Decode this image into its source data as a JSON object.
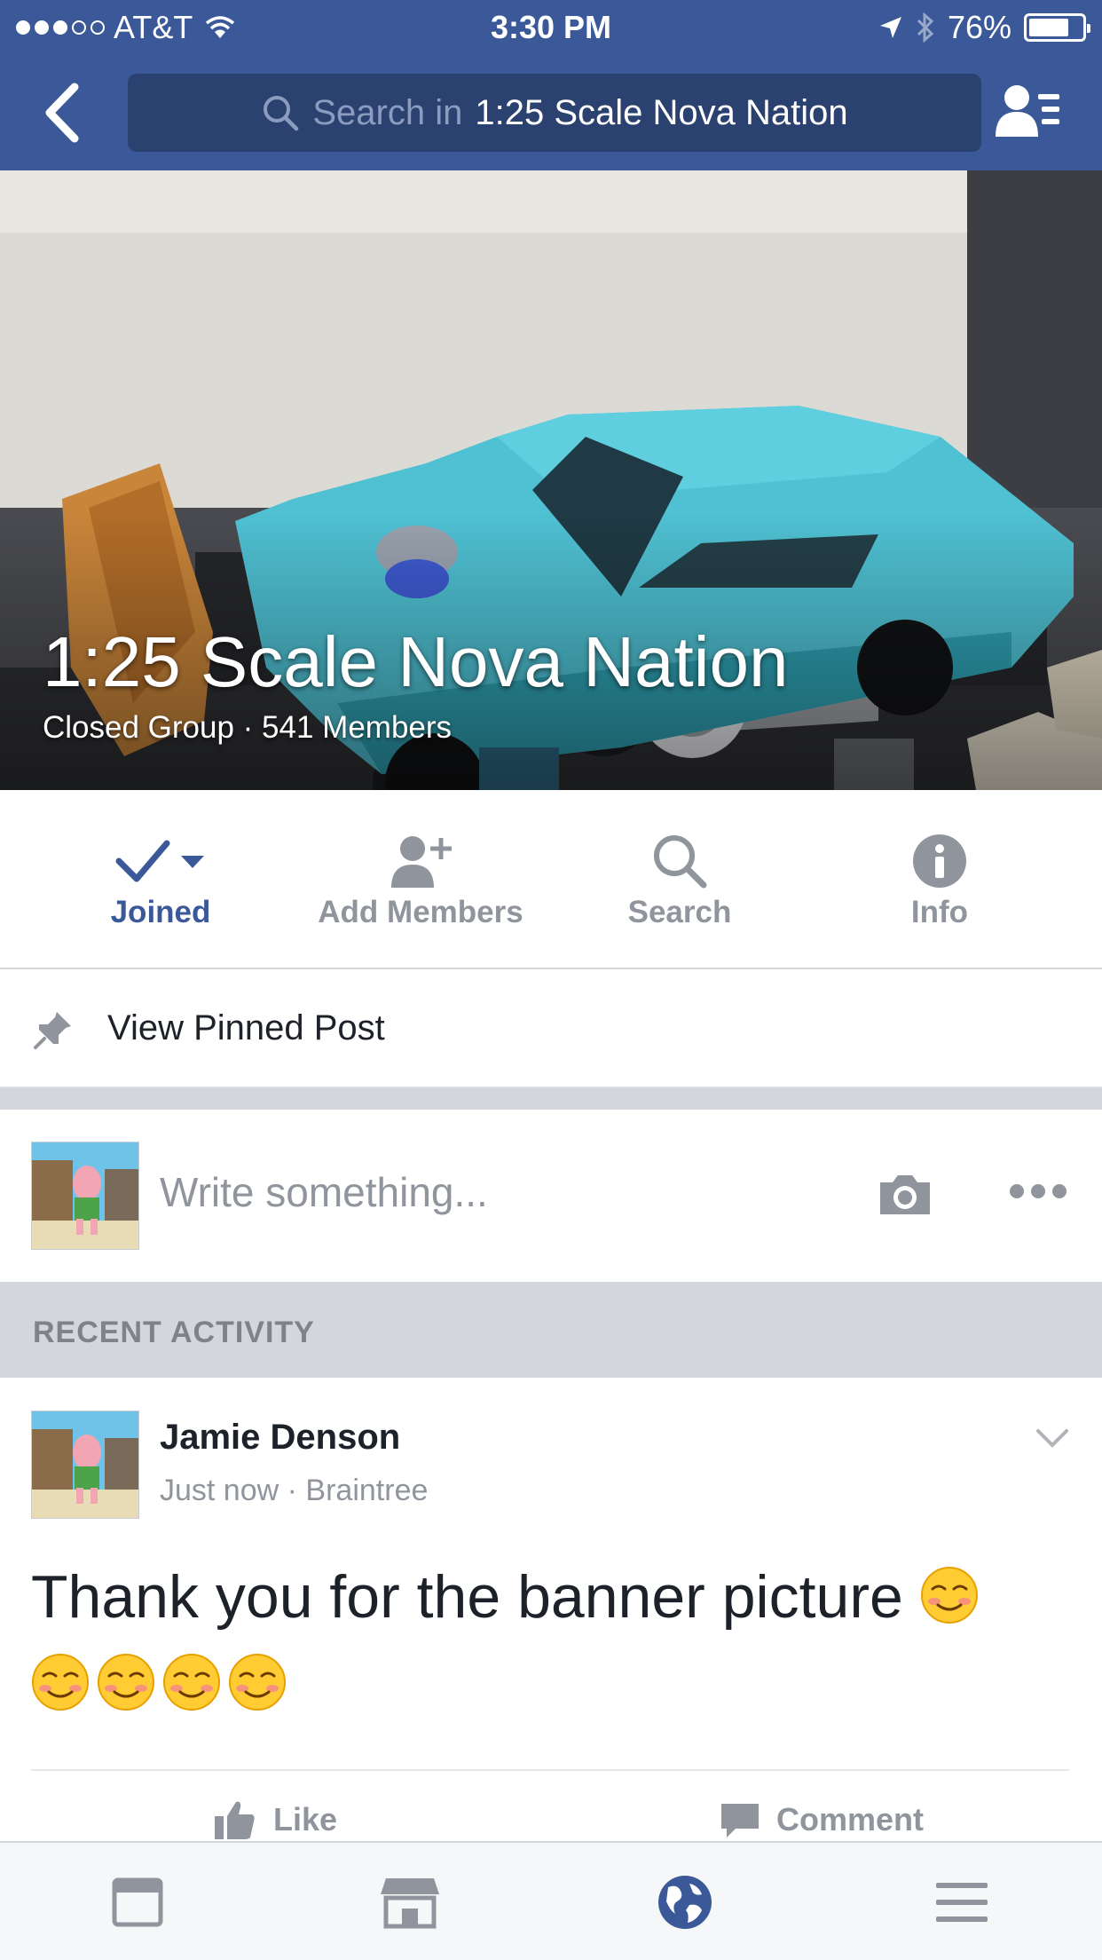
{
  "status_bar": {
    "carrier": "AT&T",
    "time": "3:30 PM",
    "battery": "76%",
    "battery_level": 0.76
  },
  "nav": {
    "search_placeholder": "Search in",
    "search_group": "1:25 Scale Nova Nation"
  },
  "cover": {
    "title": "1:25 Scale Nova Nation",
    "subtitle": "Closed Group · 541 Members"
  },
  "actions": [
    {
      "label": "Joined",
      "icon": "check-icon"
    },
    {
      "label": "Add Members",
      "icon": "add-person-icon"
    },
    {
      "label": "Search",
      "icon": "search-icon"
    },
    {
      "label": "Info",
      "icon": "info-icon"
    }
  ],
  "pinned": {
    "label": "View Pinned Post"
  },
  "composer": {
    "placeholder": "Write something..."
  },
  "section": {
    "label": "RECENT ACTIVITY"
  },
  "post": {
    "author": "Jamie Denson",
    "time": "Just now",
    "location": "Braintree",
    "separator": "·",
    "text": "Thank you for the banner picture",
    "emoji_count": 5,
    "like_label": "Like",
    "comment_label": "Comment"
  },
  "tabs": [
    {
      "icon": "news-feed-icon"
    },
    {
      "icon": "marketplace-icon"
    },
    {
      "icon": "globe-icon"
    },
    {
      "icon": "menu-icon"
    }
  ],
  "colors": {
    "brand": "#3b5998",
    "search_bg": "#2b4170",
    "muted": "#90949c",
    "car": "#4fc1d3"
  }
}
